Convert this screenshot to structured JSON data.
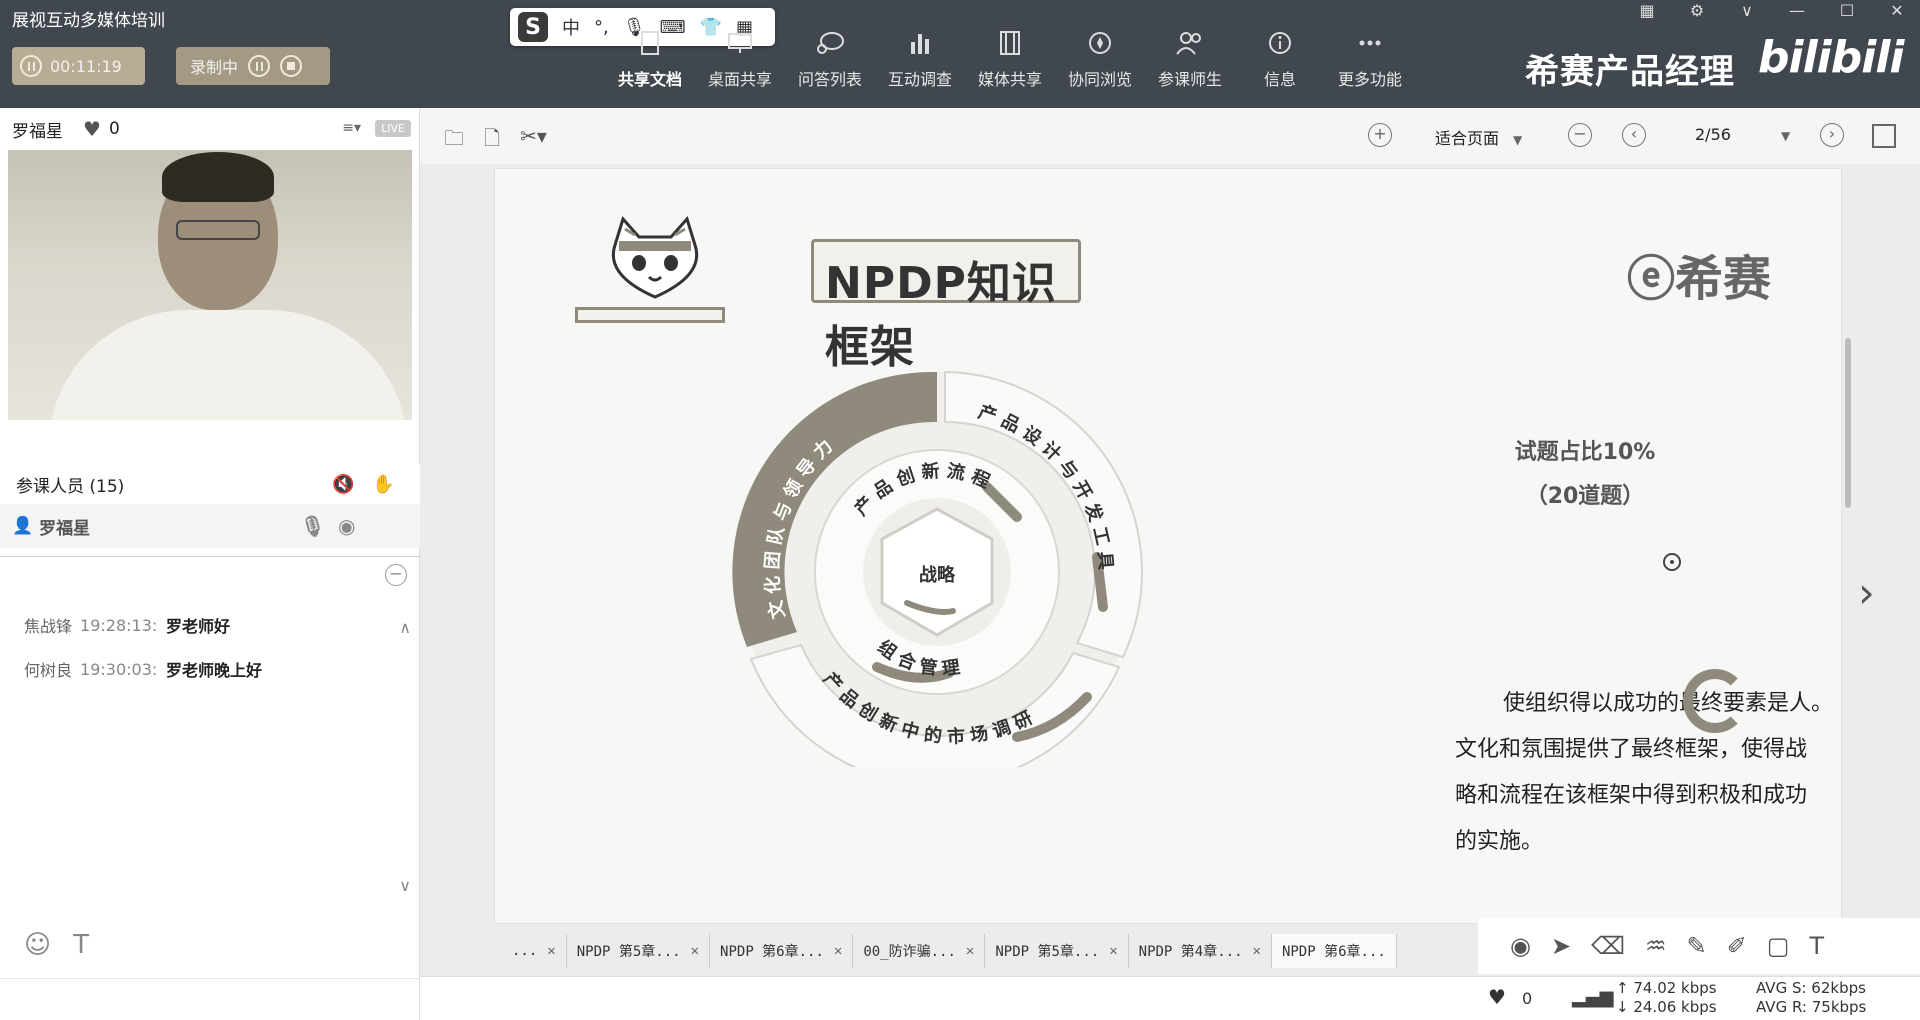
{
  "window": {
    "title": "展视互动多媒体培训"
  },
  "session": {
    "elapsed": "00:11:19",
    "record_label": "录制中"
  },
  "ime": {
    "logo": "S",
    "lang": "中",
    "punct": "°,"
  },
  "toolbar": {
    "items": [
      {
        "label": "共享文档",
        "icon": "document-icon",
        "active": true
      },
      {
        "label": "桌面共享",
        "icon": "monitor-icon"
      },
      {
        "label": "问答列表",
        "icon": "chat-bubble-icon"
      },
      {
        "label": "互动调查",
        "icon": "bar-chart-icon"
      },
      {
        "label": "媒体共享",
        "icon": "film-icon"
      },
      {
        "label": "协同浏览",
        "icon": "compass-icon"
      },
      {
        "label": "参课师生",
        "icon": "users-icon"
      },
      {
        "label": "信息",
        "icon": "info-icon"
      },
      {
        "label": "更多功能",
        "icon": "more-icon"
      }
    ]
  },
  "branding": {
    "name": "希赛产品经理",
    "site": "bilibili"
  },
  "host": {
    "name": "罗福星",
    "likes": "0",
    "live": "LIVE"
  },
  "attendees": {
    "label": "参课人员 (15)",
    "member": "罗福星"
  },
  "chat": {
    "messages": [
      {
        "user": "焦战锋",
        "time": "19:28:13:",
        "text": "罗老师好"
      },
      {
        "user": "何树良",
        "time": "19:30:03:",
        "text": "罗老师晚上好"
      }
    ]
  },
  "viewer": {
    "zoom": "适合页面",
    "page": "2/56"
  },
  "slide": {
    "title": "NPDP知识框架",
    "logo": "希赛",
    "ring_outer_left": "文化团队与领导力",
    "ring_outer_right": "产品设计与开发工具",
    "ring_outer_bottom": "产品创新中的市场调研",
    "ring_inner_top": "产品创新流程",
    "ring_inner_bottom": "组合管理",
    "center": "战略",
    "ratio_line1": "试题占比10%",
    "ratio_line2": "（20道题）",
    "desc_line1": "使组织得以成功的最终要素是人。",
    "desc_line2": "文化和氛围提供了最终框架，使得战",
    "desc_line3": "略和流程在该框架中得到积极和成功",
    "desc_line4": "的实施。"
  },
  "tabs": [
    {
      "label": "..."
    },
    {
      "label": "NPDP 第5章..."
    },
    {
      "label": "NPDP 第6章..."
    },
    {
      "label": "00_防诈骗..."
    },
    {
      "label": "NPDP 第5章..."
    },
    {
      "label": "NPDP 第4章..."
    },
    {
      "label": "NPDP 第6章...",
      "active": true
    }
  ],
  "status": {
    "likes": "0",
    "up": "74.02 kbps",
    "down": "24.06 kbps",
    "avg_s": "AVG S: 62kbps",
    "avg_r": "AVG R: 75kbps"
  },
  "colors": {
    "accent": "#8f8a7c",
    "topbar": "#40474f"
  }
}
